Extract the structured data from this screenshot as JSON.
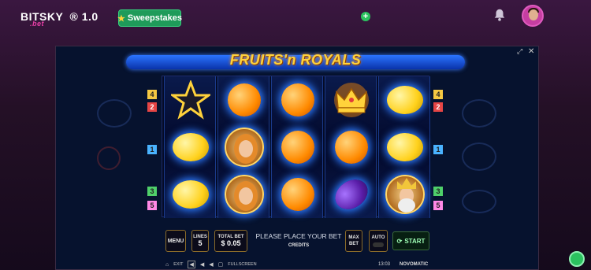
{
  "header": {
    "logo_main": "BITSKY",
    "logo_sub": ".bet",
    "version": "® 1.0",
    "sweepstakes_label": "Sweepstakes",
    "plus_label": "+"
  },
  "game": {
    "title": "FRUITS'n ROYALS",
    "line_markers_left": [
      {
        "label": "4",
        "color": "#f5c842"
      },
      {
        "label": "2",
        "color": "#e64545"
      },
      {
        "label": "1",
        "color": "#4ab3ff"
      },
      {
        "label": "3",
        "color": "#4fd06a"
      },
      {
        "label": "5",
        "color": "#ff88e6"
      }
    ],
    "line_markers_right": [
      {
        "label": "4",
        "color": "#f5c842"
      },
      {
        "label": "2",
        "color": "#e64545"
      },
      {
        "label": "1",
        "color": "#4ab3ff"
      },
      {
        "label": "3",
        "color": "#4fd06a"
      },
      {
        "label": "5",
        "color": "#ff88e6"
      }
    ],
    "reels": [
      [
        "star",
        "lemon",
        "lemon"
      ],
      [
        "orange",
        "queen",
        "queen"
      ],
      [
        "orange",
        "orange",
        "orange"
      ],
      [
        "crown",
        "orange",
        "plum"
      ],
      [
        "lemon",
        "lemon",
        "king"
      ]
    ],
    "controls": {
      "menu_label": "MENU",
      "lines_label": "LINES",
      "lines_value": "5",
      "total_bet_label": "TOTAL BET",
      "total_bet_value": "$ 0.05",
      "message": "PLEASE PLACE YOUR BET",
      "credits_label": "CREDITS",
      "max_bet_label": "MAX BET",
      "auto_label": "AUTO",
      "start_label": "START"
    },
    "bottom": {
      "exit_label": "EXIT",
      "fullscreen_label": "FULLSCREEN",
      "time": "13:03",
      "brand": "NOVOMATIC"
    }
  }
}
